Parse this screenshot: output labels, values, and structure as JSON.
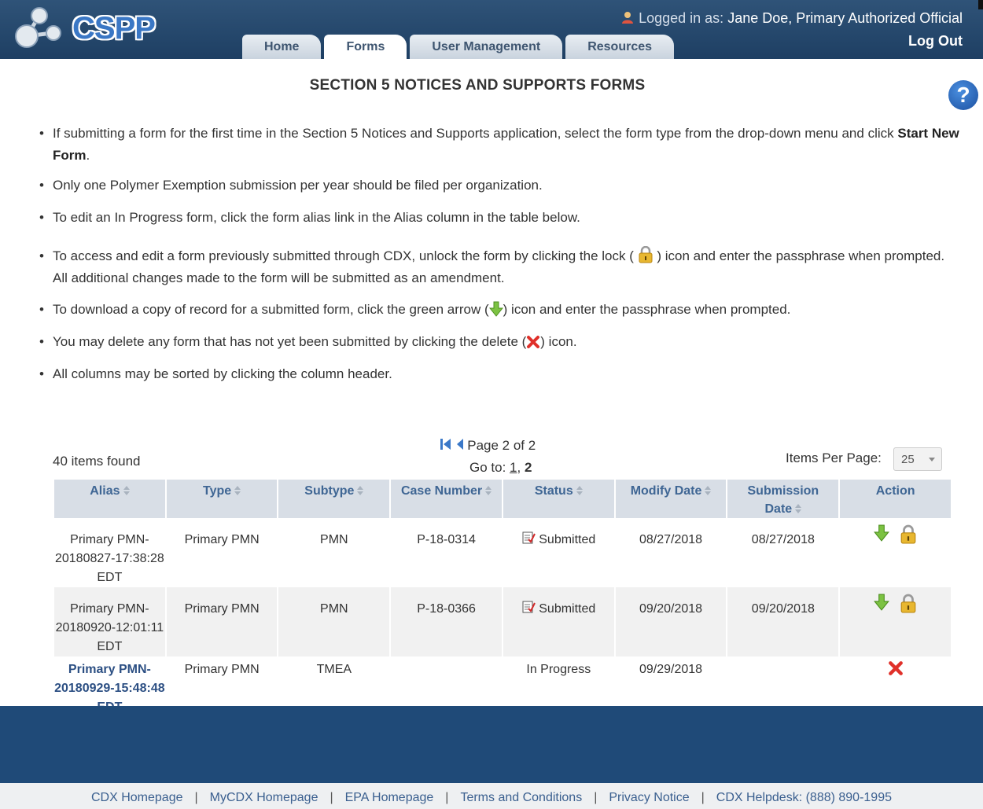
{
  "header": {
    "logo_text": "CSPP",
    "tabs": [
      {
        "label": "Home"
      },
      {
        "label": "Forms"
      },
      {
        "label": "User Management"
      },
      {
        "label": "Resources"
      }
    ],
    "user_label": "Logged in as:",
    "user_name": "Jane Doe, Primary Authorized Official",
    "logout_label": "Log Out"
  },
  "page": {
    "title": "SECTION 5 NOTICES AND SUPPORTS FORMS",
    "help_glyph": "?"
  },
  "instructions": {
    "i1_a": "If submitting a form for the first time in the Section 5 Notices and Supports application, select the form type from the drop-down menu and click ",
    "i1_b": "Start New Form",
    "i1_c": ".",
    "i2": "Only one Polymer Exemption submission per year should be filed per organization.",
    "i3": "To edit an In Progress form, click the form alias link in the Alias column in the table below.",
    "i4_a": "To access and edit a form previously submitted through CDX, unlock the form by clicking the lock (",
    "i4_b": ") icon and enter the passphrase when prompted. All additional changes made to the form will be submitted as an amendment.",
    "i5_a": "To download a copy of record for a submitted form, click the green arrow (",
    "i5_b": ") icon and enter the passphrase when prompted.",
    "i6_a": "You may delete any form that has not yet been submitted by clicking the delete (",
    "i6_b": ") icon.",
    "i7": "All columns may be sorted by clicking the column header."
  },
  "pager": {
    "items_found": "40 items found",
    "page_text": "Page 2 of 2",
    "goto_label": "Go to:",
    "page_1": "1",
    "page_sep": ",",
    "page_2": "2",
    "items_per_page_label": "Items Per Page:",
    "items_per_page_value": "25"
  },
  "table": {
    "headers": {
      "alias": "Alias",
      "type": "Type",
      "subtype": "Subtype",
      "case_number": "Case Number",
      "status": "Status",
      "modify_date": "Modify Date",
      "submission_date_1": "Submission",
      "submission_date_2": "Date",
      "action": "Action"
    },
    "rows": [
      {
        "alias_1": "Primary PMN-",
        "alias_2": "20180827-17:38:28",
        "alias_3": "EDT",
        "type": "Primary PMN",
        "subtype": "PMN",
        "case_number": "P-18-0314",
        "status": "Submitted",
        "modify_date": "08/27/2018",
        "submission_date": "08/27/2018"
      },
      {
        "alias_1": "Primary PMN-",
        "alias_2": "20180920-12:01:11",
        "alias_3": "EDT",
        "type": "Primary PMN",
        "subtype": "PMN",
        "case_number": "P-18-0366",
        "status": "Submitted",
        "modify_date": "09/20/2018",
        "submission_date": "09/20/2018"
      },
      {
        "alias_1": "Primary PMN-",
        "alias_2": "20180929-15:48:48",
        "alias_3": "EDT",
        "type": "Primary PMN",
        "subtype": "TMEA",
        "case_number": "",
        "status": "In Progress",
        "modify_date": "09/29/2018",
        "submission_date": ""
      }
    ]
  },
  "footer": {
    "links": [
      "CDX Homepage",
      "MyCDX Homepage",
      "EPA Homepage",
      "Terms and Conditions",
      "Privacy Notice",
      "CDX Helpdesk: (888) 890-1995"
    ],
    "separator": "|"
  },
  "colors": {
    "header_bg": "#1e3f63",
    "footer_bg": "#1f4a78",
    "link": "#2c4f83",
    "header_cell_bg": "#d8dee6"
  },
  "icons": [
    "user-icon",
    "logo-molecule-icon",
    "help-icon",
    "lock-icon",
    "green-download-arrow-icon",
    "red-x-delete-icon",
    "first-page-icon",
    "prev-page-icon",
    "sort-icon",
    "submitted-document-icon",
    "dropdown-caret-icon"
  ]
}
